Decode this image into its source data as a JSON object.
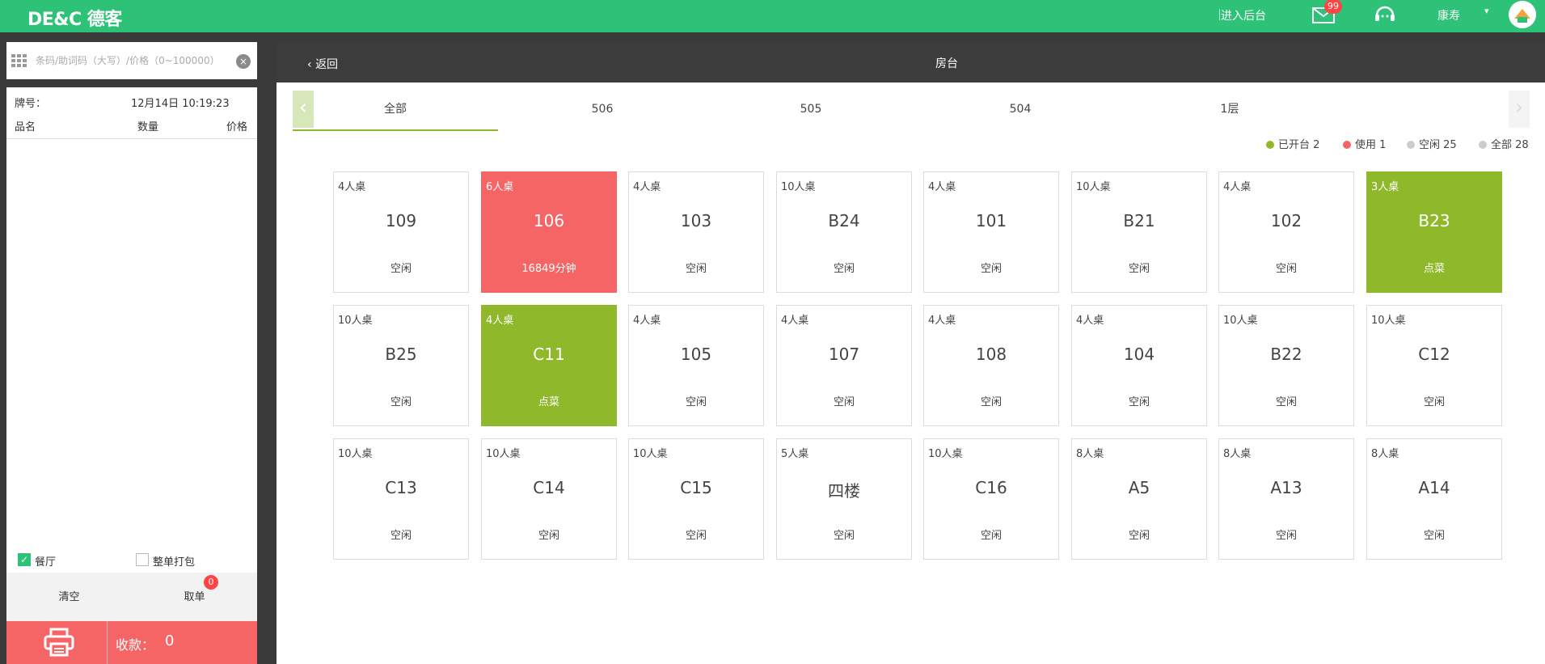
{
  "brand": {
    "logo_text": "DE&C 德客"
  },
  "topbar": {
    "admin_link": "进入后台",
    "mail_badge": "99",
    "user_name": "康寿",
    "caret": "▾"
  },
  "search": {
    "placeholder": "条码/助词码（大写）/价格（0~100000）"
  },
  "order": {
    "card_label": "牌号：",
    "time": "12月14日 10:19:23",
    "col_name": "品名",
    "col_qty": "数量",
    "col_price": "价格",
    "dine_in": "餐厅",
    "takeaway": "整单打包",
    "clear": "清空",
    "pickup": "取单",
    "pickup_badge": "0",
    "collect_label": "收款：",
    "collect_amount": "0"
  },
  "main": {
    "back": "返回",
    "title": "房台",
    "tabs": [
      {
        "label": "全部",
        "active": true
      },
      {
        "label": "506",
        "active": false
      },
      {
        "label": "505",
        "active": false
      },
      {
        "label": "504",
        "active": false
      },
      {
        "label": "1层",
        "active": false
      }
    ],
    "legend": [
      {
        "label": "已开台 2",
        "color": "#8fb92b"
      },
      {
        "label": "使用 1",
        "color": "#f56565"
      },
      {
        "label": "空闲 25",
        "color": "#cccccc"
      },
      {
        "label": "全部 28",
        "color": "#cccccc"
      }
    ],
    "tables": [
      {
        "size": "4人桌",
        "name": "109",
        "status": "空闲",
        "state": "idle"
      },
      {
        "size": "6人桌",
        "name": "106",
        "status": "16849分钟",
        "state": "using"
      },
      {
        "size": "4人桌",
        "name": "103",
        "status": "空闲",
        "state": "idle"
      },
      {
        "size": "10人桌",
        "name": "B24",
        "status": "空闲",
        "state": "idle"
      },
      {
        "size": "4人桌",
        "name": "101",
        "status": "空闲",
        "state": "idle"
      },
      {
        "size": "10人桌",
        "name": "B21",
        "status": "空闲",
        "state": "idle"
      },
      {
        "size": "4人桌",
        "name": "102",
        "status": "空闲",
        "state": "idle"
      },
      {
        "size": "3人桌",
        "name": "B23",
        "status": "点菜",
        "state": "open"
      },
      {
        "size": "10人桌",
        "name": "B25",
        "status": "空闲",
        "state": "idle"
      },
      {
        "size": "4人桌",
        "name": "C11",
        "status": "点菜",
        "state": "open"
      },
      {
        "size": "4人桌",
        "name": "105",
        "status": "空闲",
        "state": "idle"
      },
      {
        "size": "4人桌",
        "name": "107",
        "status": "空闲",
        "state": "idle"
      },
      {
        "size": "4人桌",
        "name": "108",
        "status": "空闲",
        "state": "idle"
      },
      {
        "size": "4人桌",
        "name": "104",
        "status": "空闲",
        "state": "idle"
      },
      {
        "size": "10人桌",
        "name": "B22",
        "status": "空闲",
        "state": "idle"
      },
      {
        "size": "10人桌",
        "name": "C12",
        "status": "空闲",
        "state": "idle"
      },
      {
        "size": "10人桌",
        "name": "C13",
        "status": "空闲",
        "state": "idle"
      },
      {
        "size": "10人桌",
        "name": "C14",
        "status": "空闲",
        "state": "idle"
      },
      {
        "size": "10人桌",
        "name": "C15",
        "status": "空闲",
        "state": "idle"
      },
      {
        "size": "5人桌",
        "name": "四楼",
        "status": "空闲",
        "state": "idle"
      },
      {
        "size": "10人桌",
        "name": "C16",
        "status": "空闲",
        "state": "idle"
      },
      {
        "size": "8人桌",
        "name": "A5",
        "status": "空闲",
        "state": "idle"
      },
      {
        "size": "8人桌",
        "name": "A13",
        "status": "空闲",
        "state": "idle"
      },
      {
        "size": "8人桌",
        "name": "A14",
        "status": "空闲",
        "state": "idle"
      }
    ]
  },
  "icons": {
    "mail": "mail-icon",
    "support": "headset-icon",
    "avatar": "avatar-icon",
    "grid": "grid-icon",
    "clear": "clear-icon",
    "printer": "printer-icon",
    "check": "check-icon",
    "back": "chevron-left-icon"
  }
}
